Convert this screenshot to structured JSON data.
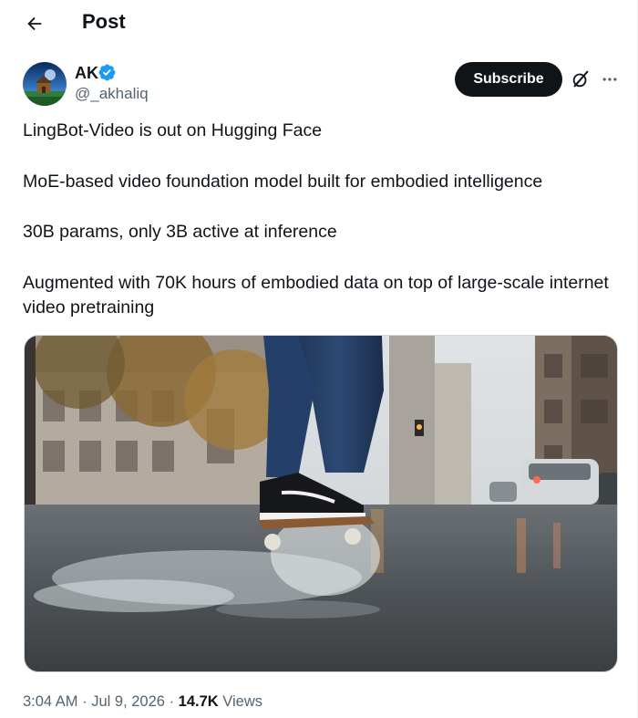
{
  "header": {
    "title": "Post"
  },
  "author": {
    "name": "AK",
    "handle": "@_akhaliq",
    "verified": true
  },
  "actions": {
    "subscribe_label": "Subscribe"
  },
  "icons": {
    "back": "arrow-left-icon",
    "verified": "verified-badge-icon",
    "grok": "grok-icon",
    "more": "more-horizontal-icon"
  },
  "tweet": {
    "paragraphs": [
      "LingBot-Video is out on Hugging Face",
      "MoE-based video foundation model built for embodied intelligence",
      "30B params, only 3B active at inference",
      "Augmented with 70K hours of embodied data on top of large-scale internet video pretraining"
    ]
  },
  "meta": {
    "time": "3:04 AM",
    "date": "Jul 9, 2026",
    "separator": "·",
    "views_count": "14.7K",
    "views_label": "Views"
  },
  "colors": {
    "text_primary": "#0f1419",
    "text_secondary": "#536471",
    "verified_blue": "#1d9bf0",
    "button_dark": "#0f1419"
  }
}
